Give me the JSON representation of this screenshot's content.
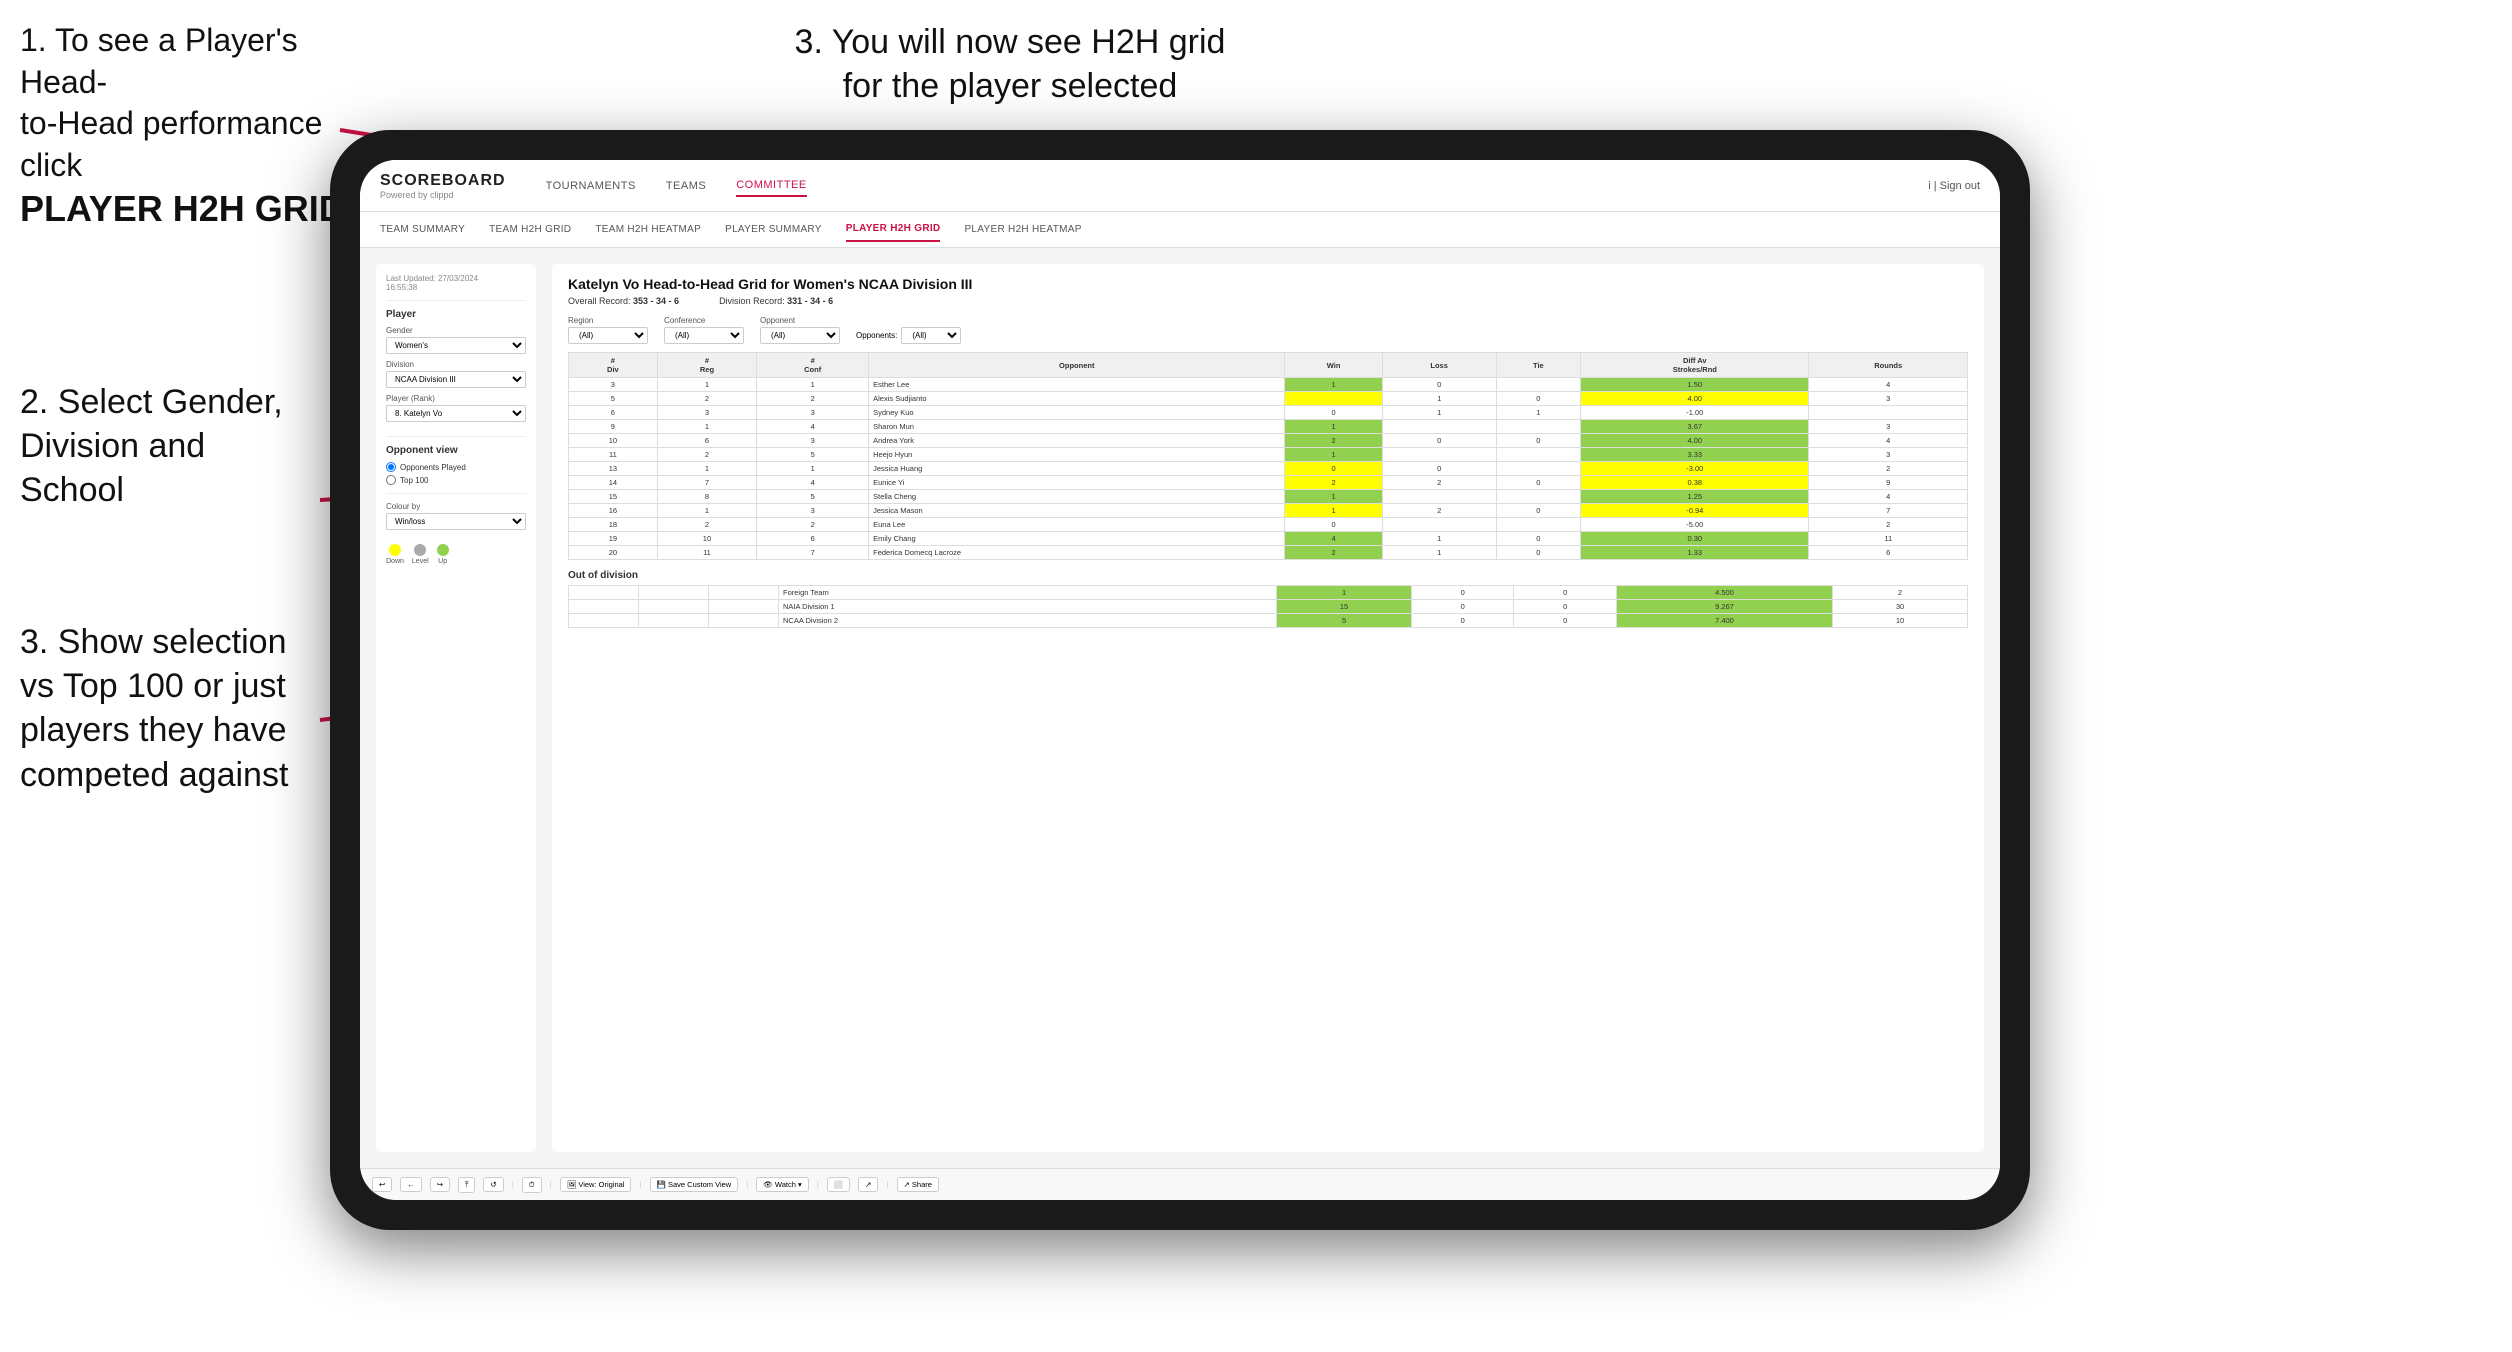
{
  "instructions": {
    "top_left_line1": "1. To see a Player's Head-",
    "top_left_line2": "to-Head performance click",
    "top_left_bold": "PLAYER H2H GRID",
    "top_right": "3. You will now see H2H grid\nfor the player selected",
    "mid_left_title": "2. Select Gender,\nDivision and\nSchool",
    "bot_left": "3. Show selection\nvs Top 100 or just\nplayers they have\ncompeted against"
  },
  "navbar": {
    "logo_main": "SCOREBOARD",
    "logo_sub": "Powered by clippd",
    "links": [
      "TOURNAMENTS",
      "TEAMS",
      "COMMITTEE"
    ],
    "active_link": "COMMITTEE",
    "sign_in": "i | Sign out"
  },
  "subnav": {
    "links": [
      "TEAM SUMMARY",
      "TEAM H2H GRID",
      "TEAM H2H HEATMAP",
      "PLAYER SUMMARY",
      "PLAYER H2H GRID",
      "PLAYER H2H HEATMAP"
    ],
    "active": "PLAYER H2H GRID"
  },
  "left_panel": {
    "updated": "Last Updated: 27/03/2024\n16:55:38",
    "player_section": "Player",
    "gender_label": "Gender",
    "gender_value": "Women's",
    "division_label": "Division",
    "division_value": "NCAA Division III",
    "player_rank_label": "Player (Rank)",
    "player_rank_value": "8. Katelyn Vo",
    "opponent_view_title": "Opponent view",
    "opponent_options": [
      "Opponents Played",
      "Top 100"
    ],
    "opponent_selected": "Opponents Played",
    "colour_by_label": "Colour by",
    "colour_by_value": "Win/loss",
    "legend": [
      {
        "color": "#ffff00",
        "label": "Down"
      },
      {
        "color": "#aaaaaa",
        "label": "Level"
      },
      {
        "color": "#92d050",
        "label": "Up"
      }
    ]
  },
  "main_grid": {
    "title": "Katelyn Vo Head-to-Head Grid for Women's NCAA Division III",
    "overall_record": "353 - 34 - 6",
    "division_record": "331 - 34 - 6",
    "region_filter_label": "Region",
    "region_filter_value": "All",
    "conference_filter_label": "Conference",
    "conference_filter_value": "All",
    "opponent_filter_label": "Opponent",
    "opponent_filter_value": "All",
    "opponents_label": "Opponents:",
    "table_headers": [
      "#\nDiv",
      "#\nReg",
      "#\nConf",
      "Opponent",
      "Win",
      "Loss",
      "Tie",
      "Diff Av\nStrokes/Rnd",
      "Rounds"
    ],
    "rows": [
      {
        "div": "3",
        "reg": "1",
        "conf": "1",
        "opponent": "Esther Lee",
        "win": "1",
        "loss": "0",
        "tie": "",
        "diff": "1.50",
        "rounds": "4",
        "win_color": "green"
      },
      {
        "div": "5",
        "reg": "2",
        "conf": "2",
        "opponent": "Alexis Sudjianto",
        "win": "",
        "loss": "1",
        "tie": "0",
        "diff": "4.00",
        "rounds": "3",
        "win_color": "yellow"
      },
      {
        "div": "6",
        "reg": "3",
        "conf": "3",
        "opponent": "Sydney Kuo",
        "win": "0",
        "loss": "1",
        "tie": "1",
        "diff": "-1.00",
        "rounds": "",
        "win_color": ""
      },
      {
        "div": "9",
        "reg": "1",
        "conf": "4",
        "opponent": "Sharon Mun",
        "win": "1",
        "loss": "",
        "tie": "",
        "diff": "3.67",
        "rounds": "3",
        "win_color": "green"
      },
      {
        "div": "10",
        "reg": "6",
        "conf": "3",
        "opponent": "Andrea York",
        "win": "2",
        "loss": "0",
        "tie": "0",
        "diff": "4.00",
        "rounds": "4",
        "win_color": "green"
      },
      {
        "div": "11",
        "reg": "2",
        "conf": "5",
        "opponent": "Heejo Hyun",
        "win": "1",
        "loss": "",
        "tie": "",
        "diff": "3.33",
        "rounds": "3",
        "win_color": "green"
      },
      {
        "div": "13",
        "reg": "1",
        "conf": "1",
        "opponent": "Jessica Huang",
        "win": "0",
        "loss": "0",
        "tie": "",
        "diff": "-3.00",
        "rounds": "2",
        "win_color": "yellow"
      },
      {
        "div": "14",
        "reg": "7",
        "conf": "4",
        "opponent": "Eunice Yi",
        "win": "2",
        "loss": "2",
        "tie": "0",
        "diff": "0.38",
        "rounds": "9",
        "win_color": "yellow"
      },
      {
        "div": "15",
        "reg": "8",
        "conf": "5",
        "opponent": "Stella Cheng",
        "win": "1",
        "loss": "",
        "tie": "",
        "diff": "1.25",
        "rounds": "4",
        "win_color": "green"
      },
      {
        "div": "16",
        "reg": "1",
        "conf": "3",
        "opponent": "Jessica Mason",
        "win": "1",
        "loss": "2",
        "tie": "0",
        "diff": "-0.94",
        "rounds": "7",
        "win_color": "yellow"
      },
      {
        "div": "18",
        "reg": "2",
        "conf": "2",
        "opponent": "Euna Lee",
        "win": "0",
        "loss": "",
        "tie": "",
        "diff": "-5.00",
        "rounds": "2",
        "win_color": ""
      },
      {
        "div": "19",
        "reg": "10",
        "conf": "6",
        "opponent": "Emily Chang",
        "win": "4",
        "loss": "1",
        "tie": "0",
        "diff": "0.30",
        "rounds": "11",
        "win_color": "green"
      },
      {
        "div": "20",
        "reg": "11",
        "conf": "7",
        "opponent": "Federica Domecq Lacroze",
        "win": "2",
        "loss": "1",
        "tie": "0",
        "diff": "1.33",
        "rounds": "6",
        "win_color": "green"
      }
    ],
    "out_of_division_title": "Out of division",
    "ood_rows": [
      {
        "label": "Foreign Team",
        "win": "1",
        "loss": "0",
        "tie": "0",
        "diff": "4.500",
        "rounds": "2"
      },
      {
        "label": "NAIA Division 1",
        "win": "15",
        "loss": "0",
        "tie": "0",
        "diff": "9.267",
        "rounds": "30"
      },
      {
        "label": "NCAA Division 2",
        "win": "5",
        "loss": "0",
        "tie": "0",
        "diff": "7.400",
        "rounds": "10"
      }
    ]
  },
  "toolbar": {
    "buttons": [
      "↩",
      "←",
      "↪",
      "⤒",
      "↺",
      "·",
      "⏱",
      "View: Original",
      "Save Custom View",
      "Watch ▾",
      "⬜",
      "↗",
      "Share"
    ]
  }
}
